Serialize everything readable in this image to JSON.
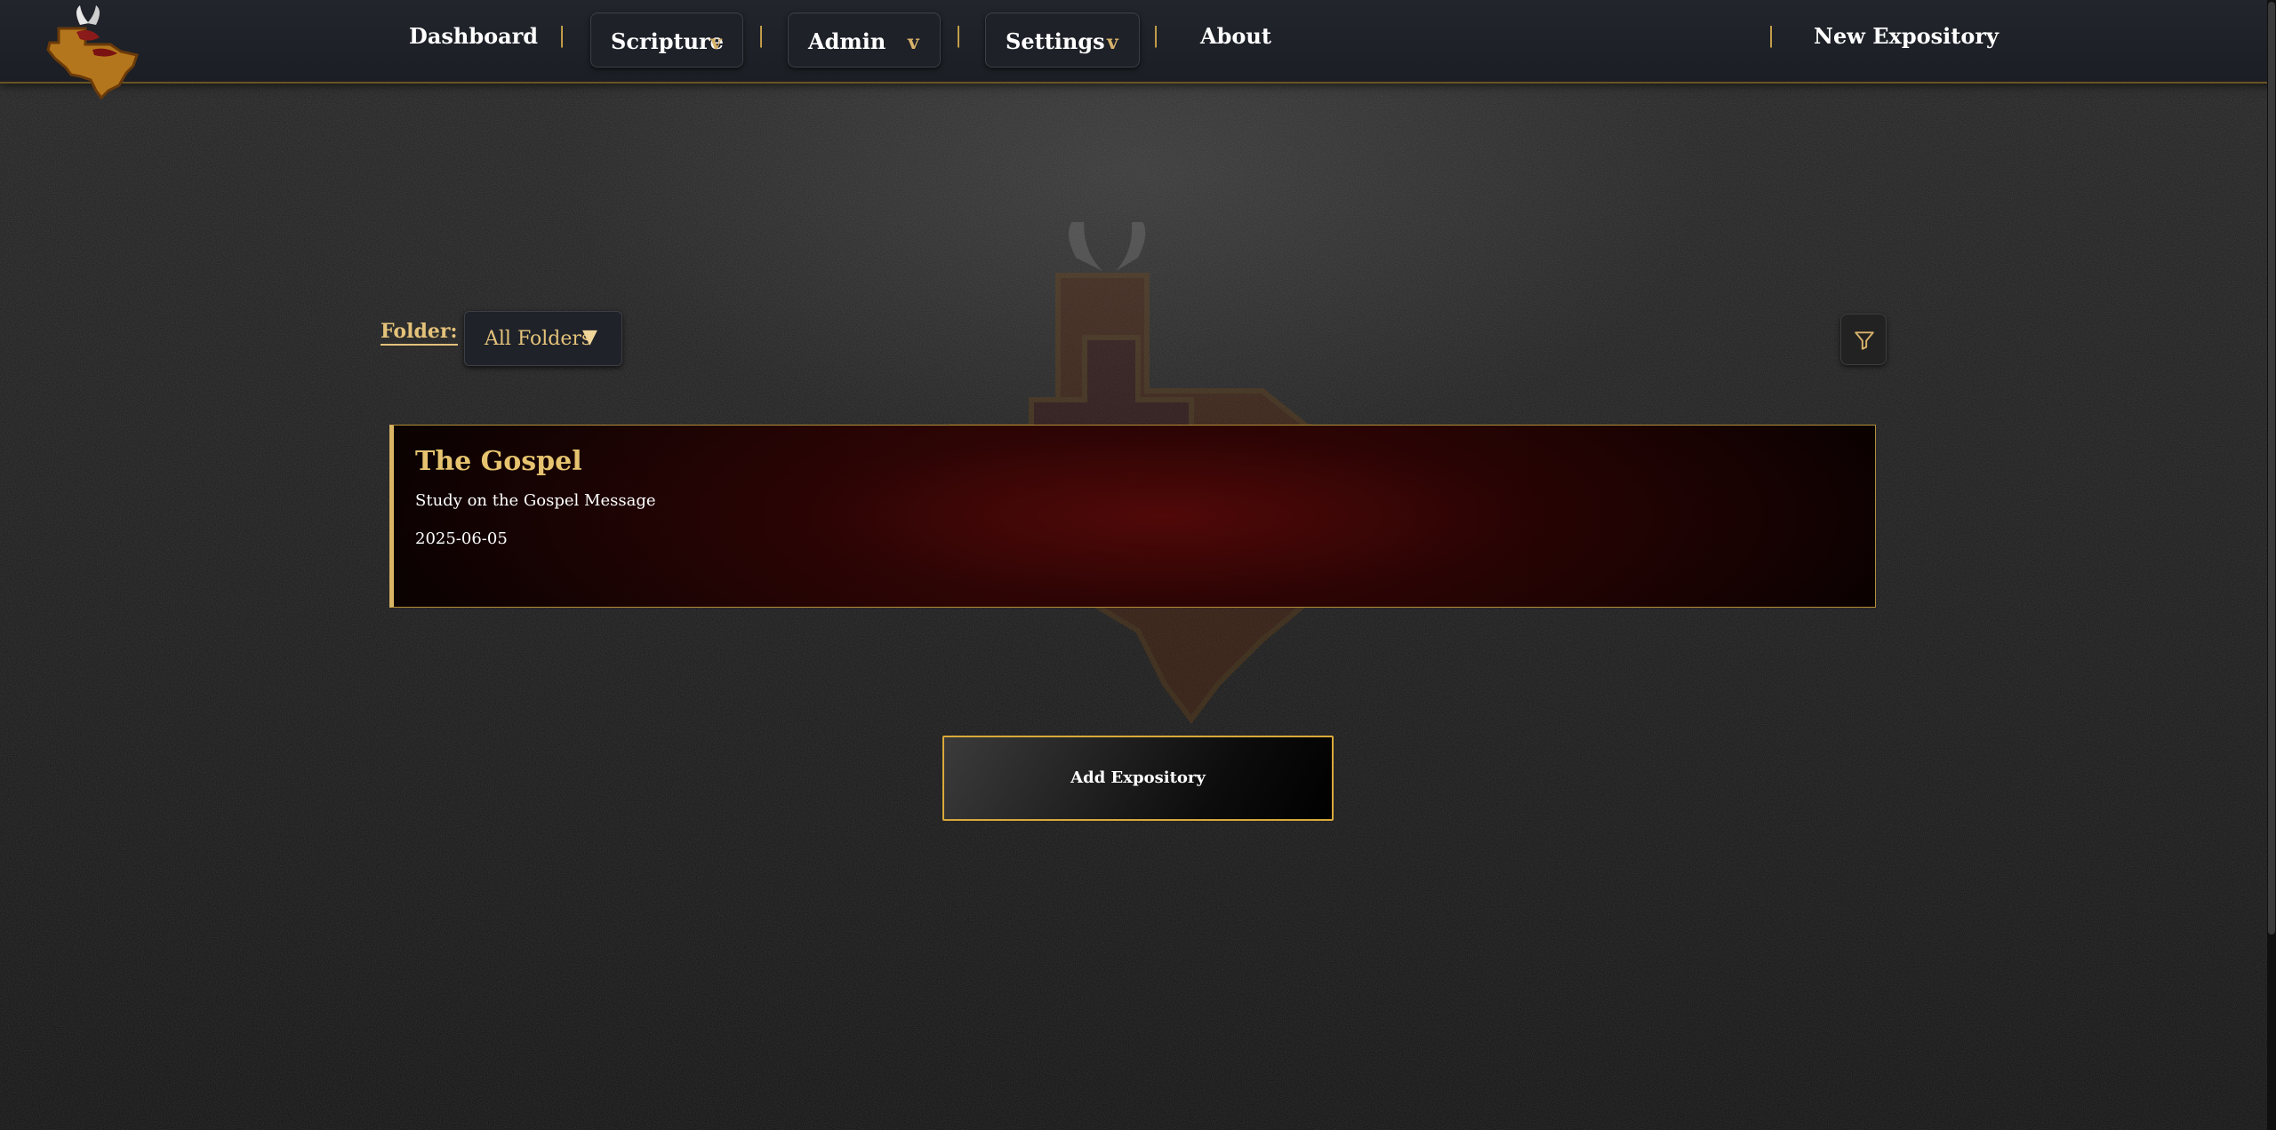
{
  "nav": {
    "dashboard": "Dashboard",
    "separator": "|",
    "scripture": "Scripture",
    "admin": "Admin",
    "settings": "Settings",
    "dropdown_caret": "v",
    "about": "About",
    "new_expository": "New Expository"
  },
  "filters": {
    "folder_label": "Folder:",
    "folder_value": "All Folders",
    "folder_caret": "▼"
  },
  "expositories": [
    {
      "title": "The Gospel",
      "description": "Study on the Gospel Message",
      "date": "2025-06-05"
    }
  ],
  "actions": {
    "add_expository": "Add Expository"
  },
  "colors": {
    "accent_gold": "#e4c27a",
    "border_gold": "#d9a93a",
    "nav_bg": "#1f2229",
    "card_red": "#3a0606"
  },
  "icons": {
    "logo": "texas-bull-logo",
    "filter": "filter-funnel-icon",
    "background": "texas-bull-watermark"
  }
}
